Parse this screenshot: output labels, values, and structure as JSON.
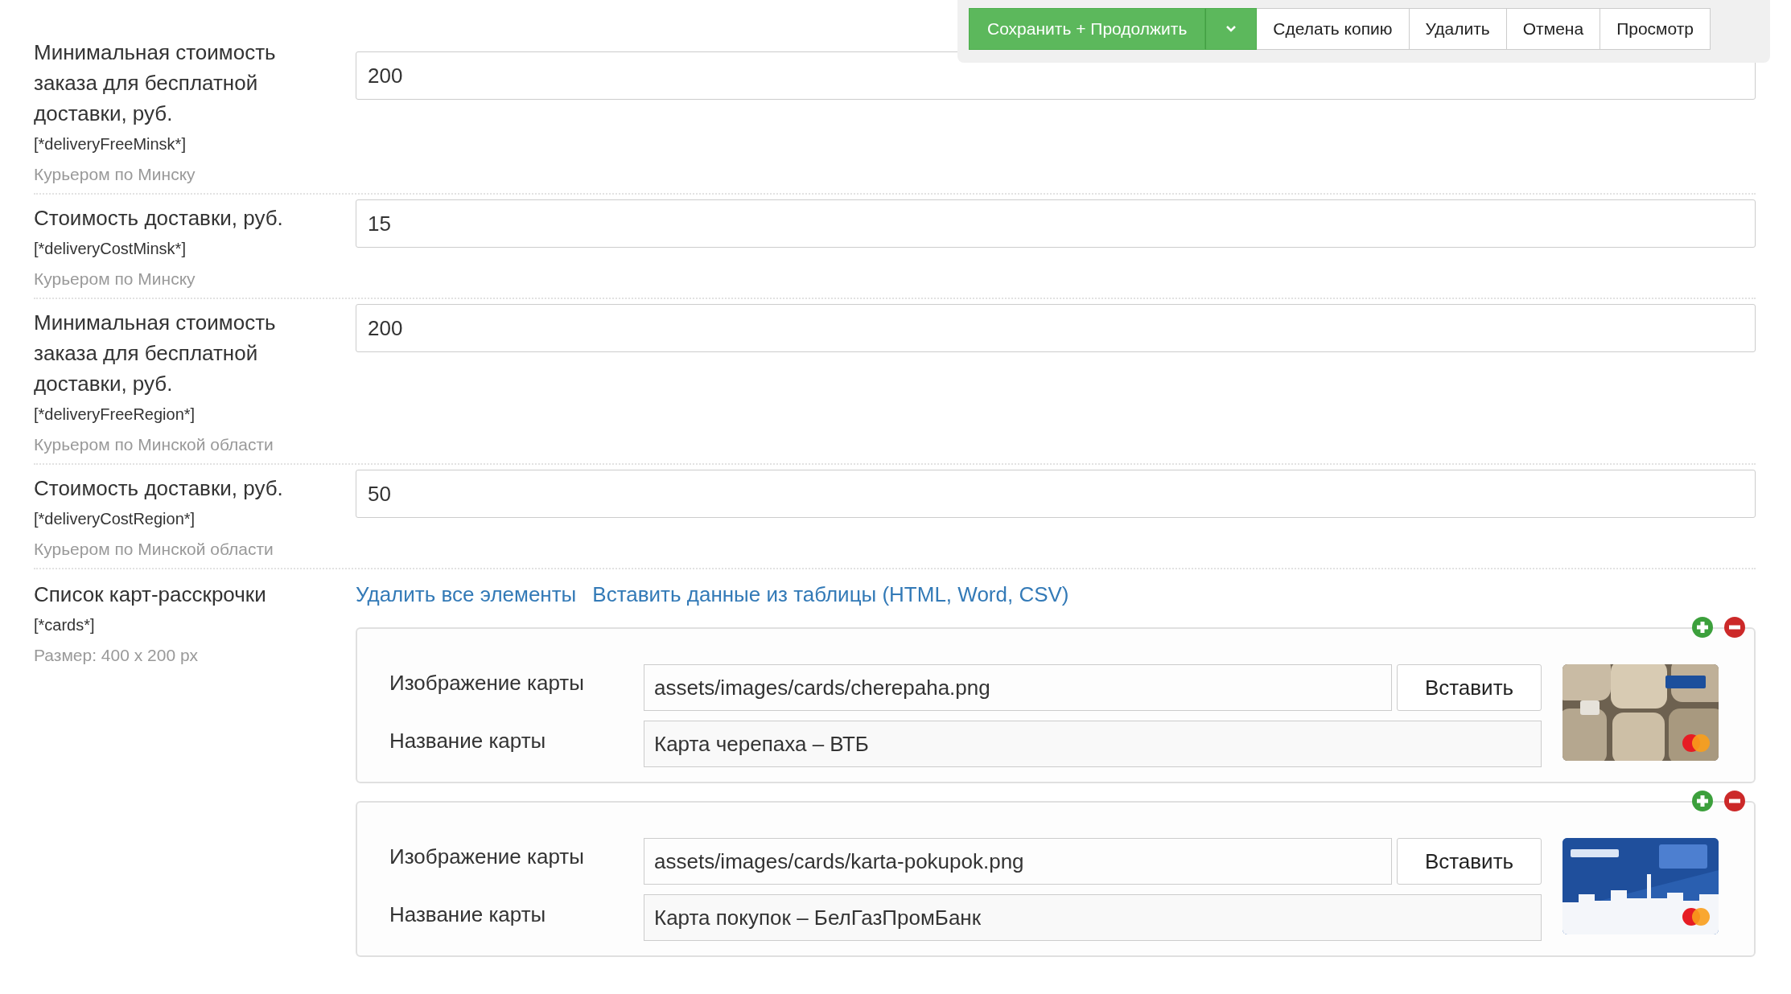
{
  "toolbar": {
    "primary": "Сохранить + Продолжить",
    "buttons": [
      "Сделать копию",
      "Удалить",
      "Отмена",
      "Просмотр"
    ]
  },
  "fields": [
    {
      "label": "Минимальная стоимость заказа для бесплатной доставки, руб.",
      "key": "[*deliveryFreeMinsk*]",
      "note": "Курьером по Минску",
      "value": "200"
    },
    {
      "label": "Стоимость доставки, руб.",
      "key": "[*deliveryCostMinsk*]",
      "note": "Курьером по Минску",
      "value": "15"
    },
    {
      "label": "Минимальная стоимость заказа для бесплатной доставки, руб.",
      "key": "[*deliveryFreeRegion*]",
      "note": "Курьером по Минской области",
      "value": "200"
    },
    {
      "label": "Стоимость доставки, руб.",
      "key": "[*deliveryCostRegion*]",
      "note": "Курьером по Минской области",
      "value": "50"
    }
  ],
  "cards_field": {
    "label": "Список карт-расскрочки",
    "key": "[*cards*]",
    "note": "Размер: 400 x 200 px",
    "links": [
      "Удалить все элементы",
      "Вставить данные из таблицы (HTML, Word, CSV)"
    ],
    "items": [
      {
        "image_label": "Изображение карты",
        "image_path": "assets/images/cards/cherepaha.png",
        "insert_button": "Вставить",
        "name_label": "Название карты",
        "name": "Карта черепаха – ВТБ"
      },
      {
        "image_label": "Изображение карты",
        "image_path": "assets/images/cards/karta-pokupok.png",
        "insert_button": "Вставить",
        "name_label": "Название карты",
        "name": "Карта покупок – БелГазПромБанк"
      }
    ]
  }
}
